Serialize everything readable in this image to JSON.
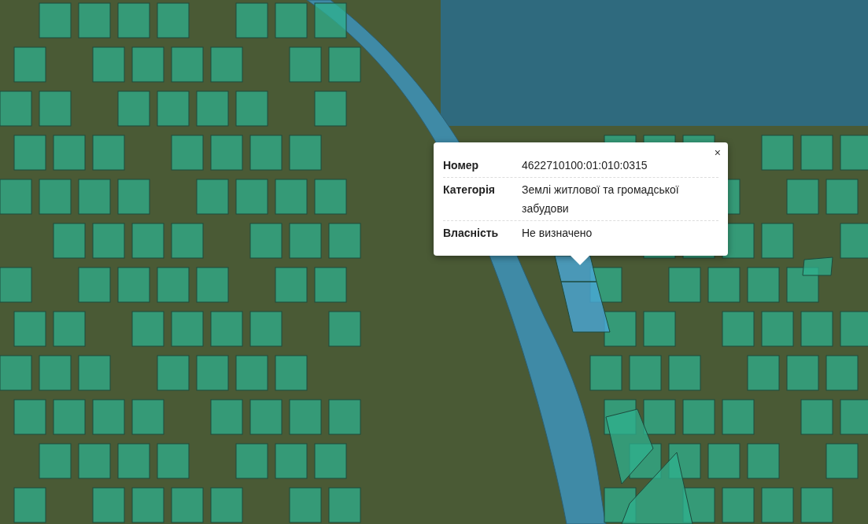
{
  "popup": {
    "close": "×",
    "rows": [
      {
        "label": "Номер",
        "value": "4622710100:01:010:0315"
      },
      {
        "label": "Категорія",
        "value": "Землі житлової та громадської забудови"
      },
      {
        "label": "Власність",
        "value": "Не визначено"
      }
    ]
  }
}
